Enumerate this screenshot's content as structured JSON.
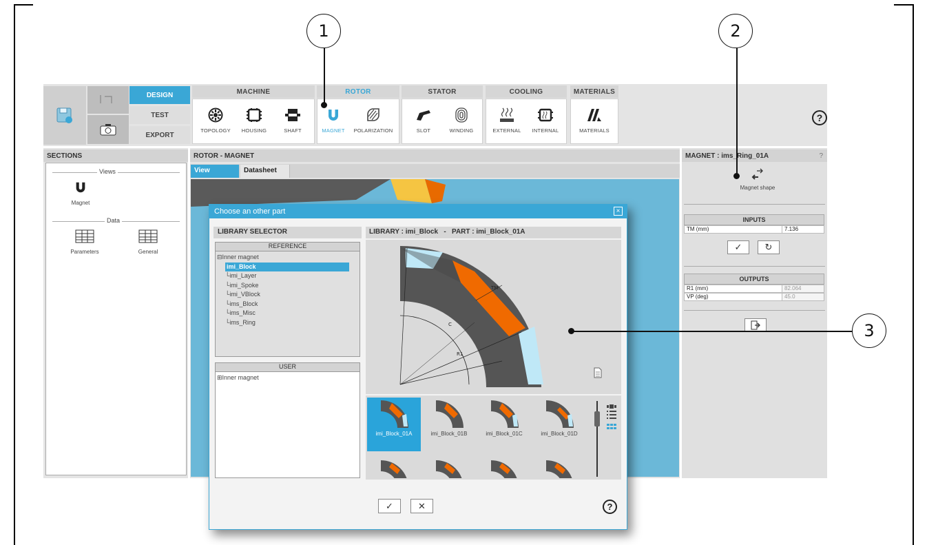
{
  "callouts": [
    "1",
    "2",
    "3"
  ],
  "toolbar": {
    "modes": [
      "DESIGN",
      "TEST",
      "EXPORT"
    ],
    "groups": {
      "machine": {
        "title": "MACHINE",
        "tools": [
          "TOPOLOGY",
          "HOUSING",
          "SHAFT"
        ]
      },
      "rotor": {
        "title": "ROTOR",
        "tools": [
          "MAGNET",
          "POLARIZATION"
        ]
      },
      "stator": {
        "title": "STATOR",
        "tools": [
          "SLOT",
          "WINDING"
        ]
      },
      "cooling": {
        "title": "COOLING",
        "tools": [
          "EXTERNAL",
          "INTERNAL"
        ]
      },
      "materials": {
        "title": "MATERIALS",
        "tools": [
          "MATERIALS"
        ]
      }
    },
    "help": "?"
  },
  "sections": {
    "title": "SECTIONS",
    "views_label": "Views",
    "views": [
      "Magnet"
    ],
    "data_label": "Data",
    "data_items": [
      "Parameters",
      "General"
    ]
  },
  "center": {
    "title": "ROTOR - MAGNET",
    "tabs": [
      "View",
      "Datasheet"
    ]
  },
  "right_panel": {
    "title": "MAGNET : ims_Ring_01A",
    "help": "?",
    "shape_label": "Magnet shape",
    "inputs_title": "INPUTS",
    "inputs": [
      {
        "name": "TM (mm)",
        "value": "7.136"
      }
    ],
    "outputs_title": "OUTPUTS",
    "outputs": [
      {
        "name": "R1 (mm)",
        "value": "82.064"
      },
      {
        "name": "VP (deg)",
        "value": "45.0"
      }
    ]
  },
  "dialog": {
    "title": "Choose an other part",
    "close": "⊠",
    "selector_title": "LIBRARY SELECTOR",
    "reference_title": "REFERENCE",
    "reference_root": "Inner magnet",
    "reference_items": [
      "imi_Block",
      "imi_Layer",
      "imi_Spoke",
      "imi_VBlock",
      "ims_Block",
      "ims_Misc",
      "ims_Ring"
    ],
    "user_title": "USER",
    "user_root": "Inner magnet",
    "library_title": "LIBRARY : imi_Block   -   PART : imi_Block_01A",
    "preview_labels": {
      "tm": "TM",
      "c": "C",
      "r1": "R1"
    },
    "thumbnails": [
      "imi_Block_01A",
      "imi_Block_01B",
      "imi_Block_01C",
      "imi_Block_01D"
    ],
    "help": "?"
  },
  "colors": {
    "accent": "#3aa7d6",
    "magnet": "#f06a00",
    "steel": "#555555",
    "air": "#bfe8f7"
  }
}
